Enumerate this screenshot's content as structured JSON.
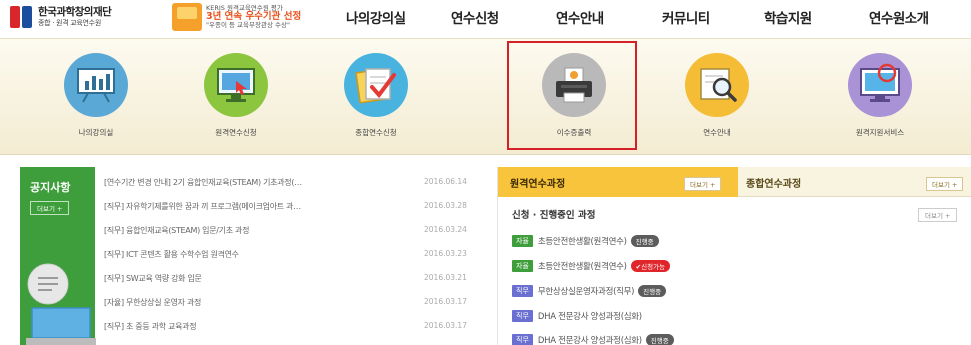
{
  "logo": {
    "title": "한국과학창의재단",
    "subtitle": "종합 · 원격 교육연수원"
  },
  "award": {
    "line1": "KERIS 원격교육연수원 평가",
    "line2": "3년 연속 우수기관 선정",
    "line3": "\"우종이 등 교육부장관상 수상\""
  },
  "nav": [
    {
      "label": "나의강의실"
    },
    {
      "label": "연수신청"
    },
    {
      "label": "연수안내"
    },
    {
      "label": "커뮤니티"
    },
    {
      "label": "학습지원"
    },
    {
      "label": "연수원소개"
    }
  ],
  "quick_menu": [
    {
      "label": "나의강의실",
      "icon": "chart-board-icon",
      "color": "#5aa8d6"
    },
    {
      "label": "원격연수신청",
      "icon": "monitor-icon",
      "color": "#8cc63f"
    },
    {
      "label": "종합연수신청",
      "icon": "folder-check-icon",
      "color": "#49b3e0"
    },
    {
      "label": "이수증출력",
      "icon": "printer-icon",
      "color": "#b9b9b9"
    },
    {
      "label": "연수안내",
      "icon": "magnifier-icon",
      "color": "#f5bd36"
    },
    {
      "label": "원격지원서비스",
      "icon": "monitor-support-icon",
      "color": "#a992d6"
    }
  ],
  "notice": {
    "title": "공지사항",
    "more": "더보기 +",
    "items": [
      {
        "title": "[연수기간 변경 안내] 2기 융합인재교육(STEAM) 기초과정(…",
        "date": "2016.06.14"
      },
      {
        "title": "[직무] 자유학기제를위한 꿈과 끼 프로그램(메이크업아트 과…",
        "date": "2016.03.28"
      },
      {
        "title": "[직무] 융합인재교육(STEAM) 입문/기초 과정",
        "date": "2016.03.24"
      },
      {
        "title": "[직무] ICT 콘텐츠 활용 수학수업 원격연수",
        "date": "2016.03.23"
      },
      {
        "title": "[직무] SW교육 역량 강화 입문",
        "date": "2016.03.21"
      },
      {
        "title": "[자율] 무한상상실 운영자 과정",
        "date": "2016.03.17"
      },
      {
        "title": "[직무] 초 중등 과학 교육과정",
        "date": "2016.03.17"
      }
    ]
  },
  "courses": {
    "tab_remote": "원격연수과정",
    "tab_remote_more": "더보기 +",
    "tab_general": "종합연수과정",
    "tab_general_more": "더보기 +",
    "section_title": "신청 · 진행중인 과정",
    "section_more": "더보기 +",
    "items": [
      {
        "tag": "자율",
        "tag_color": "#3f9e3c",
        "name": "초등안전한생활(원격연수)",
        "status": "진행중",
        "status_color": "#5c5c5c"
      },
      {
        "tag": "자율",
        "tag_color": "#3f9e3c",
        "name": "초등안전한생활(원격연수)",
        "status": "✔신청가능",
        "status_color": "#e0252b"
      },
      {
        "tag": "직무",
        "tag_color": "#6a6fd1",
        "name": "무한상상실운영자과정(직무)",
        "status": "진행중",
        "status_color": "#5c5c5c"
      },
      {
        "tag": "직무",
        "tag_color": "#6a6fd1",
        "name": "DHA 전문강사 양성과정(심화)",
        "status": "",
        "status_color": "#5c5c5c"
      },
      {
        "tag": "직무",
        "tag_color": "#6a6fd1",
        "name": "DHA 전문강사 양성과정(심화)",
        "status": "진행중",
        "status_color": "#5c5c5c"
      }
    ]
  }
}
